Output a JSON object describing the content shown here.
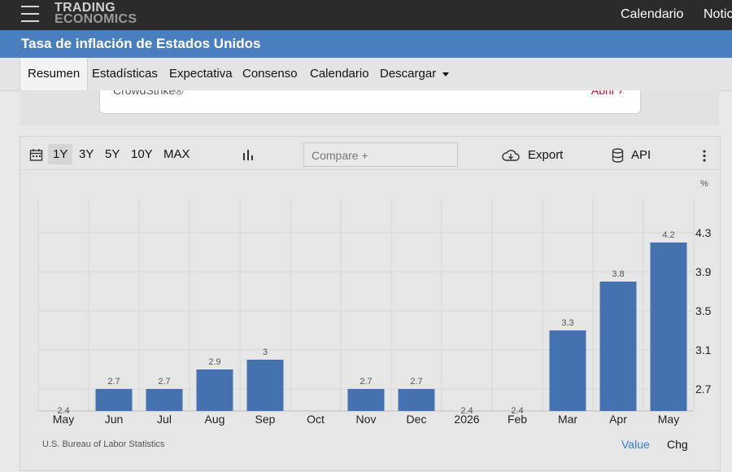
{
  "header": {
    "logo_line1": "TRADING",
    "logo_line2": "ECONOMICS",
    "nav": [
      "Calendario",
      "Notic"
    ]
  },
  "page": {
    "title": "Tasa de inflación de Estados Unidos"
  },
  "tabs": [
    {
      "label": "Resumen",
      "active": true
    },
    {
      "label": "Estadísticas"
    },
    {
      "label": "Expectativa"
    },
    {
      "label": "Consenso"
    },
    {
      "label": "Calendario"
    },
    {
      "label": "Descargar"
    }
  ],
  "ad": {
    "text": "CrowdStrike®",
    "link": "Abrir ›"
  },
  "toolbar": {
    "ranges": [
      "1Y",
      "3Y",
      "5Y",
      "10Y",
      "MAX"
    ],
    "active_range": "1Y",
    "compare_placeholder": "Compare +",
    "export_label": "Export",
    "api_label": "API"
  },
  "footer": {
    "source": "U.S. Bureau of Labor Statistics",
    "value_label": "Value",
    "chg_label": "Chg"
  },
  "colors": {
    "bar": "#4472b0",
    "header_bg": "#2b2b2b",
    "title_bg": "#4a7fbf",
    "accent_link": "#3a7fcf"
  },
  "chart_data": {
    "type": "bar",
    "categories": [
      "May",
      "Jun",
      "Jul",
      "Aug",
      "Sep",
      "Oct",
      "Nov",
      "Dec",
      "2026",
      "Feb",
      "Mar",
      "Apr",
      "May"
    ],
    "values": [
      2.4,
      2.7,
      2.7,
      2.9,
      3,
      null,
      2.7,
      2.7,
      2.4,
      2.4,
      3.3,
      3.8,
      4.2
    ],
    "data_labels": [
      "2.4",
      "2.7",
      "2.7",
      "2.9",
      "3",
      "",
      "2.7",
      "2.7",
      "2.4",
      "2.4",
      "3.3",
      "3.8",
      "4.2"
    ],
    "y_ticks": [
      2.7,
      3.1,
      3.5,
      3.9,
      4.3
    ],
    "y_unit": "%",
    "ylim": [
      2.3,
      4.5
    ],
    "grid": true,
    "y_axis_position": "right"
  }
}
